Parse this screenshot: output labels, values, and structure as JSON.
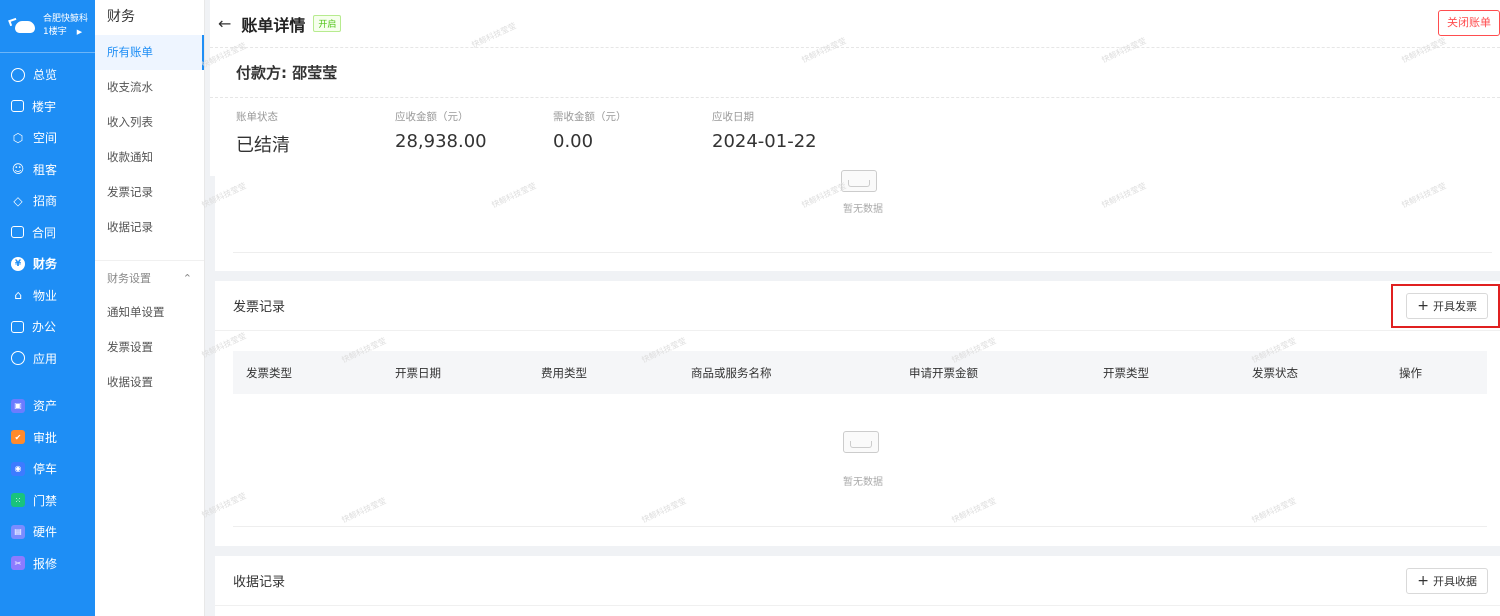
{
  "nav": {
    "company": "合肥快鲸科",
    "building": "1楼宇",
    "items": [
      {
        "label": "总览",
        "icon": "dashboard-icon"
      },
      {
        "label": "楼宇",
        "icon": "building-icon"
      },
      {
        "label": "空间",
        "icon": "cube-icon"
      },
      {
        "label": "租客",
        "icon": "users-icon"
      },
      {
        "label": "招商",
        "icon": "tag-icon"
      },
      {
        "label": "合同",
        "icon": "document-icon"
      },
      {
        "label": "财务",
        "icon": "yen-icon"
      },
      {
        "label": "物业",
        "icon": "home-icon"
      },
      {
        "label": "办公",
        "icon": "monitor-icon"
      },
      {
        "label": "应用",
        "icon": "app-icon"
      }
    ],
    "apps": [
      {
        "label": "资产",
        "color": "#6b7cff"
      },
      {
        "label": "审批",
        "color": "#ff8a2b"
      },
      {
        "label": "停车",
        "color": "#3d7bff"
      },
      {
        "label": "门禁",
        "color": "#19c37d"
      },
      {
        "label": "硬件",
        "color": "#7b8cff"
      },
      {
        "label": "报修",
        "color": "#8d7bff"
      }
    ]
  },
  "submenu": {
    "title": "财务",
    "items": [
      "所有账单",
      "收支流水",
      "收入列表",
      "收款通知",
      "发票记录",
      "收据记录"
    ],
    "group": "财务设置",
    "group_items": [
      "通知单设置",
      "发票设置",
      "收据设置"
    ]
  },
  "header": {
    "title": "账单详情",
    "tag": "开启",
    "close_label": "关闭账单"
  },
  "payer": "付款方: 邵莹莹",
  "stats": [
    {
      "label": "账单状态",
      "value": "已结清"
    },
    {
      "label": "应收金额（元）",
      "value": "28,938.00"
    },
    {
      "label": "需收金额（元）",
      "value": "0.00"
    },
    {
      "label": "应收日期",
      "value": "2024-01-22"
    }
  ],
  "empty_text": "暂无数据",
  "invoice": {
    "title": "发票记录",
    "add_label": "开具发票",
    "columns": [
      "发票类型",
      "开票日期",
      "费用类型",
      "商品或服务名称",
      "申请开票金额",
      "开票类型",
      "发票状态",
      "操作"
    ]
  },
  "receipt": {
    "title": "收据记录",
    "add_label": "开具收据"
  },
  "watermark": "快鲸科技莹莹"
}
